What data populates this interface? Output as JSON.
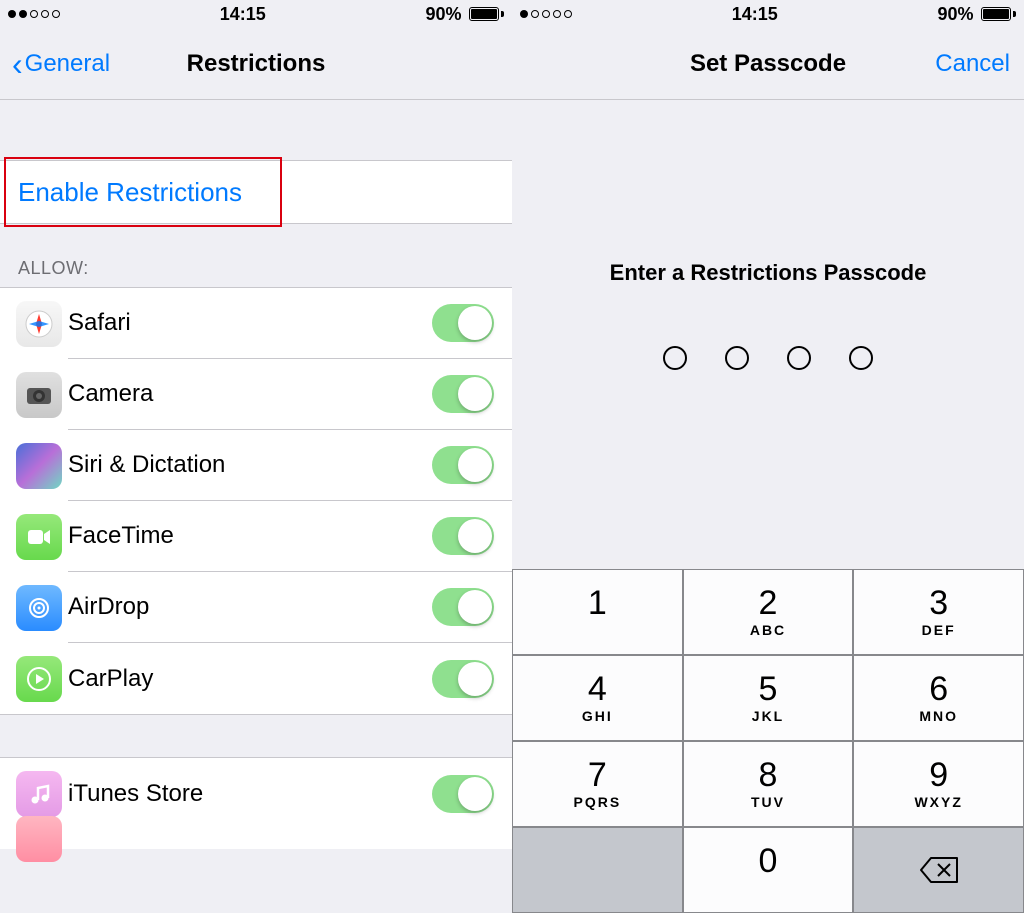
{
  "left": {
    "status": {
      "time": "14:15",
      "battery": "90%",
      "signal_dots_filled": 2,
      "signal_dots_total": 5
    },
    "nav": {
      "back": "General",
      "title": "Restrictions"
    },
    "enable_label": "Enable Restrictions",
    "allow_header": "ALLOW:",
    "apps": [
      {
        "name": "Safari",
        "icon": "ic-safari"
      },
      {
        "name": "Camera",
        "icon": "ic-camera"
      },
      {
        "name": "Siri & Dictation",
        "icon": "ic-siri"
      },
      {
        "name": "FaceTime",
        "icon": "ic-ft"
      },
      {
        "name": "AirDrop",
        "icon": "ic-airdrop"
      },
      {
        "name": "CarPlay",
        "icon": "ic-carplay"
      }
    ],
    "apps2": [
      {
        "name": "iTunes Store",
        "icon": "ic-itunes"
      }
    ]
  },
  "right": {
    "status": {
      "time": "14:15",
      "battery": "90%",
      "signal_dots_filled": 1,
      "signal_dots_total": 5
    },
    "nav": {
      "title": "Set Passcode",
      "cancel": "Cancel"
    },
    "prompt": "Enter a Restrictions Passcode",
    "passcode_length": 4,
    "keypad": [
      [
        {
          "d": "1",
          "l": ""
        },
        {
          "d": "2",
          "l": "ABC"
        },
        {
          "d": "3",
          "l": "DEF"
        }
      ],
      [
        {
          "d": "4",
          "l": "GHI"
        },
        {
          "d": "5",
          "l": "JKL"
        },
        {
          "d": "6",
          "l": "MNO"
        }
      ],
      [
        {
          "d": "7",
          "l": "PQRS"
        },
        {
          "d": "8",
          "l": "TUV"
        },
        {
          "d": "9",
          "l": "WXYZ"
        }
      ],
      [
        {
          "d": "",
          "l": "",
          "func": true
        },
        {
          "d": "0",
          "l": ""
        },
        {
          "d": "del",
          "l": "",
          "func": true
        }
      ]
    ]
  }
}
